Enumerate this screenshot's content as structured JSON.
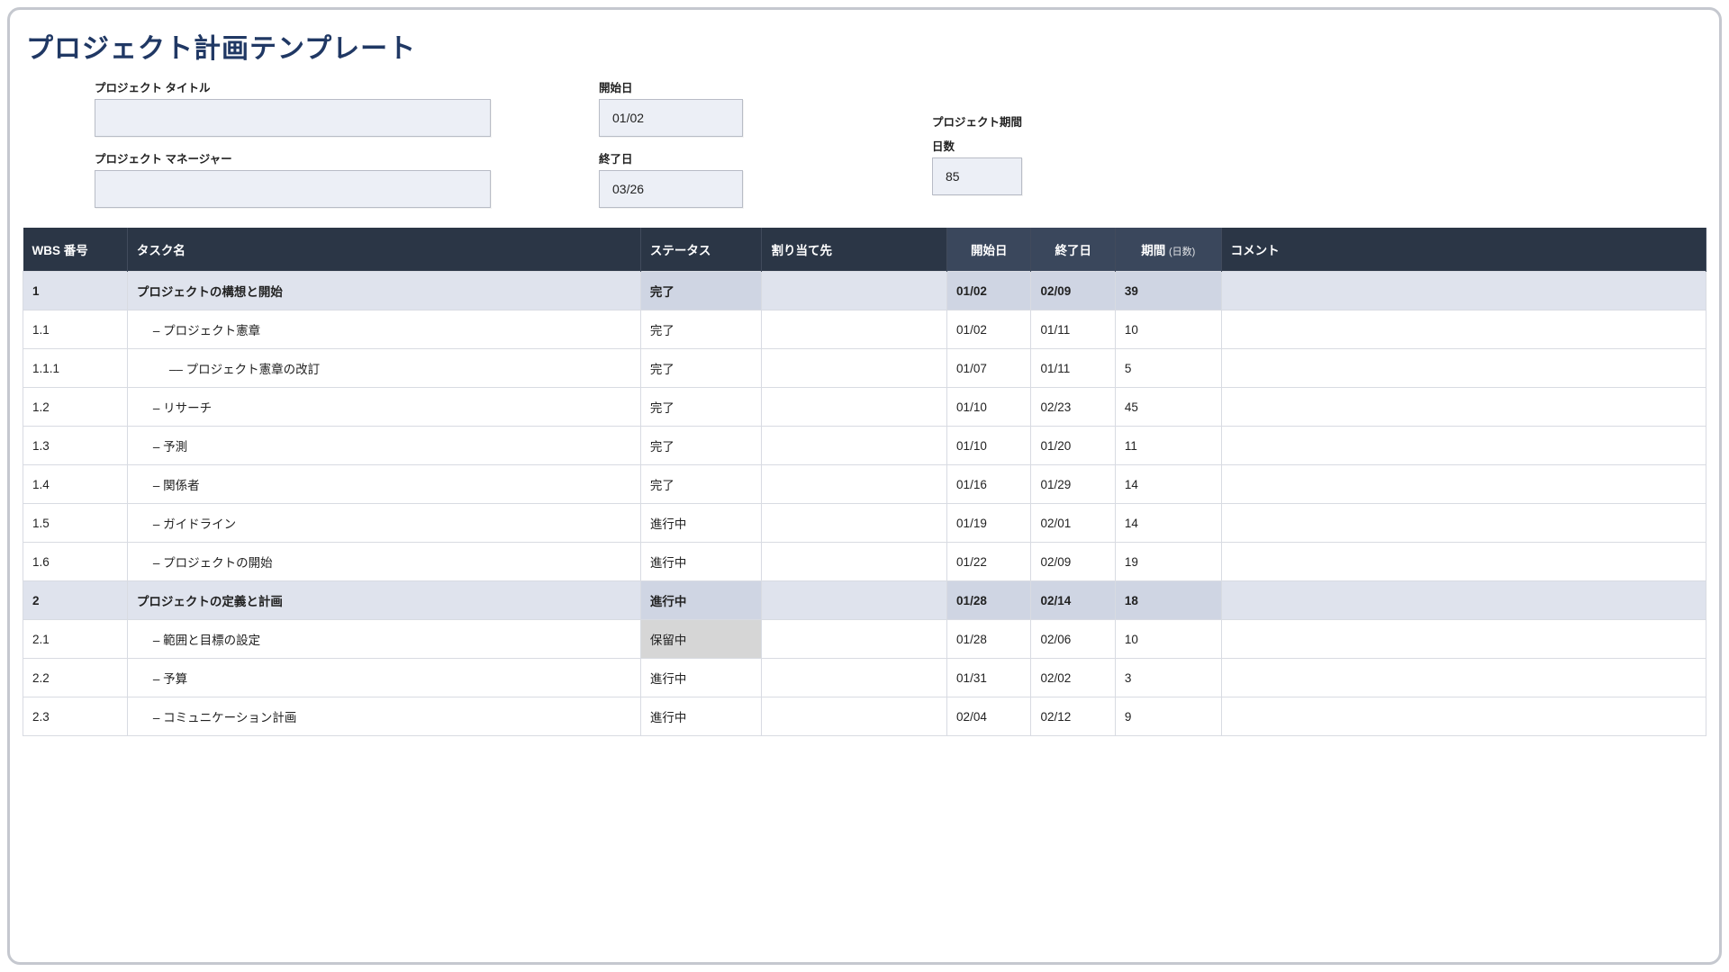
{
  "title": "プロジェクト計画テンプレート",
  "meta": {
    "project_title_label": "プロジェクト タイトル",
    "project_title_value": "",
    "project_manager_label": "プロジェクト マネージャー",
    "project_manager_value": "",
    "start_date_label": "開始日",
    "start_date_value": "01/02",
    "end_date_label": "終了日",
    "end_date_value": "03/26",
    "duration_header": "プロジェクト期間",
    "duration_label": "日数",
    "duration_value": "85"
  },
  "columns": {
    "wbs": "WBS 番号",
    "task": "タスク名",
    "status": "ステータス",
    "assignee": "割り当て先",
    "start": "開始日",
    "end": "終了日",
    "duration": "期間",
    "duration_unit": "(日数)",
    "comment": "コメント"
  },
  "rows": [
    {
      "wbs": "1",
      "indent": 0,
      "phase": true,
      "task": "プロジェクトの構想と開始",
      "status": "完了",
      "status_kind": "done",
      "assignee": "",
      "start": "01/02",
      "end": "02/09",
      "duration": "39",
      "comment": ""
    },
    {
      "wbs": "1.1",
      "indent": 1,
      "phase": false,
      "task": "プロジェクト憲章",
      "status": "完了",
      "status_kind": "done",
      "assignee": "",
      "start": "01/02",
      "end": "01/11",
      "duration": "10",
      "comment": ""
    },
    {
      "wbs": "1.1.1",
      "indent": 2,
      "phase": false,
      "task": "プロジェクト憲章の改訂",
      "status": "完了",
      "status_kind": "done",
      "assignee": "",
      "start": "01/07",
      "end": "01/11",
      "duration": "5",
      "comment": ""
    },
    {
      "wbs": "1.2",
      "indent": 1,
      "phase": false,
      "task": "リサーチ",
      "status": "完了",
      "status_kind": "done",
      "assignee": "",
      "start": "01/10",
      "end": "02/23",
      "duration": "45",
      "comment": ""
    },
    {
      "wbs": "1.3",
      "indent": 1,
      "phase": false,
      "task": "予測",
      "status": "完了",
      "status_kind": "done",
      "assignee": "",
      "start": "01/10",
      "end": "01/20",
      "duration": "11",
      "comment": ""
    },
    {
      "wbs": "1.4",
      "indent": 1,
      "phase": false,
      "task": "関係者",
      "status": "完了",
      "status_kind": "done",
      "assignee": "",
      "start": "01/16",
      "end": "01/29",
      "duration": "14",
      "comment": ""
    },
    {
      "wbs": "1.5",
      "indent": 1,
      "phase": false,
      "task": "ガイドライン",
      "status": "進行中",
      "status_kind": "prog",
      "assignee": "",
      "start": "01/19",
      "end": "02/01",
      "duration": "14",
      "comment": ""
    },
    {
      "wbs": "1.6",
      "indent": 1,
      "phase": false,
      "task": "プロジェクトの開始",
      "status": "進行中",
      "status_kind": "prog",
      "assignee": "",
      "start": "01/22",
      "end": "02/09",
      "duration": "19",
      "comment": ""
    },
    {
      "wbs": "2",
      "indent": 0,
      "phase": true,
      "task": "プロジェクトの定義と計画",
      "status": "進行中",
      "status_kind": "prog",
      "assignee": "",
      "start": "01/28",
      "end": "02/14",
      "duration": "18",
      "comment": ""
    },
    {
      "wbs": "2.1",
      "indent": 1,
      "phase": false,
      "task": "範囲と目標の設定",
      "status": "保留中",
      "status_kind": "hold",
      "assignee": "",
      "start": "01/28",
      "end": "02/06",
      "duration": "10",
      "comment": ""
    },
    {
      "wbs": "2.2",
      "indent": 1,
      "phase": false,
      "task": "予算",
      "status": "進行中",
      "status_kind": "prog",
      "assignee": "",
      "start": "01/31",
      "end": "02/02",
      "duration": "3",
      "comment": ""
    },
    {
      "wbs": "2.3",
      "indent": 1,
      "phase": false,
      "task": "コミュニケーション計画",
      "status": "進行中",
      "status_kind": "prog",
      "assignee": "",
      "start": "02/04",
      "end": "02/12",
      "duration": "9",
      "comment": ""
    }
  ]
}
